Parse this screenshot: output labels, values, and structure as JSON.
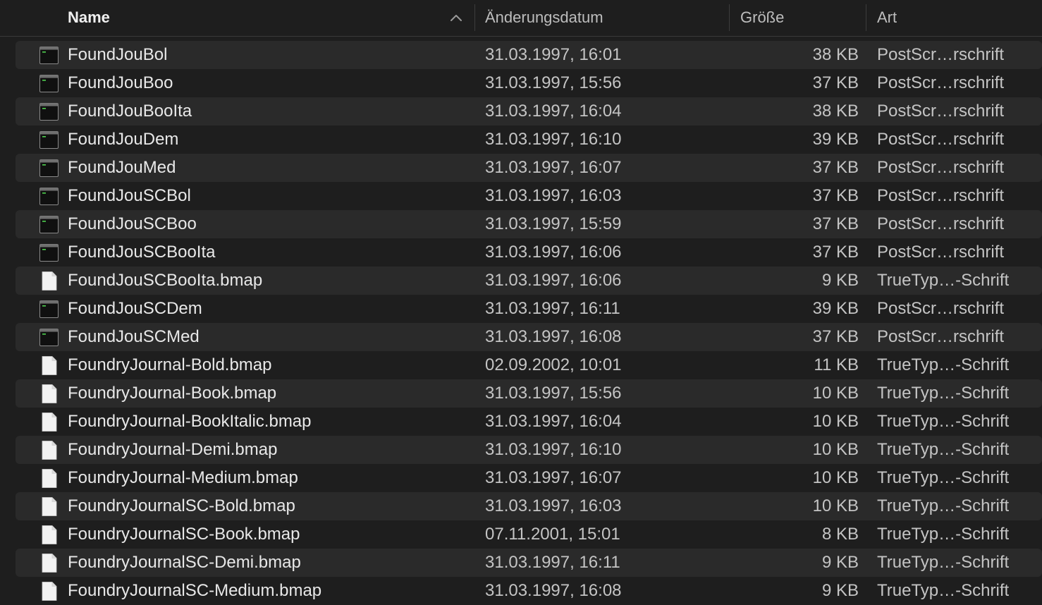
{
  "header": {
    "name_label": "Name",
    "date_label": "Änderungsdatum",
    "size_label": "Größe",
    "kind_label": "Art",
    "sort_icon": "chevron-up-icon"
  },
  "colors": {
    "background": "#1e1e1e",
    "row_alt": "#2a2a2a",
    "terminal_icon_green": "#4fd14f"
  },
  "files": [
    {
      "name": "FoundJouBol",
      "date": "31.03.1997, 16:01",
      "size": "38 KB",
      "kind": "PostScr…rschrift",
      "icon": "exec-icon"
    },
    {
      "name": "FoundJouBoo",
      "date": "31.03.1997, 15:56",
      "size": "37 KB",
      "kind": "PostScr…rschrift",
      "icon": "exec-icon"
    },
    {
      "name": "FoundJouBooIta",
      "date": "31.03.1997, 16:04",
      "size": "38 KB",
      "kind": "PostScr…rschrift",
      "icon": "exec-icon"
    },
    {
      "name": "FoundJouDem",
      "date": "31.03.1997, 16:10",
      "size": "39 KB",
      "kind": "PostScr…rschrift",
      "icon": "exec-icon"
    },
    {
      "name": "FoundJouMed",
      "date": "31.03.1997, 16:07",
      "size": "37 KB",
      "kind": "PostScr…rschrift",
      "icon": "exec-icon"
    },
    {
      "name": "FoundJouSCBol",
      "date": "31.03.1997, 16:03",
      "size": "37 KB",
      "kind": "PostScr…rschrift",
      "icon": "exec-icon"
    },
    {
      "name": "FoundJouSCBoo",
      "date": "31.03.1997, 15:59",
      "size": "37 KB",
      "kind": "PostScr…rschrift",
      "icon": "exec-icon"
    },
    {
      "name": "FoundJouSCBooIta",
      "date": "31.03.1997, 16:06",
      "size": "37 KB",
      "kind": "PostScr…rschrift",
      "icon": "exec-icon"
    },
    {
      "name": "FoundJouSCBooIta.bmap",
      "date": "31.03.1997, 16:06",
      "size": "9 KB",
      "kind": "TrueTyp…-Schrift",
      "icon": "document-icon"
    },
    {
      "name": "FoundJouSCDem",
      "date": "31.03.1997, 16:11",
      "size": "39 KB",
      "kind": "PostScr…rschrift",
      "icon": "exec-icon"
    },
    {
      "name": "FoundJouSCMed",
      "date": "31.03.1997, 16:08",
      "size": "37 KB",
      "kind": "PostScr…rschrift",
      "icon": "exec-icon"
    },
    {
      "name": "FoundryJournal-Bold.bmap",
      "date": "02.09.2002, 10:01",
      "size": "11 KB",
      "kind": "TrueTyp…-Schrift",
      "icon": "document-icon"
    },
    {
      "name": "FoundryJournal-Book.bmap",
      "date": "31.03.1997, 15:56",
      "size": "10 KB",
      "kind": "TrueTyp…-Schrift",
      "icon": "document-icon"
    },
    {
      "name": "FoundryJournal-BookItalic.bmap",
      "date": "31.03.1997, 16:04",
      "size": "10 KB",
      "kind": "TrueTyp…-Schrift",
      "icon": "document-icon"
    },
    {
      "name": "FoundryJournal-Demi.bmap",
      "date": "31.03.1997, 16:10",
      "size": "10 KB",
      "kind": "TrueTyp…-Schrift",
      "icon": "document-icon"
    },
    {
      "name": "FoundryJournal-Medium.bmap",
      "date": "31.03.1997, 16:07",
      "size": "10 KB",
      "kind": "TrueTyp…-Schrift",
      "icon": "document-icon"
    },
    {
      "name": "FoundryJournalSC-Bold.bmap",
      "date": "31.03.1997, 16:03",
      "size": "10 KB",
      "kind": "TrueTyp…-Schrift",
      "icon": "document-icon"
    },
    {
      "name": "FoundryJournalSC-Book.bmap",
      "date": "07.11.2001, 15:01",
      "size": "8 KB",
      "kind": "TrueTyp…-Schrift",
      "icon": "document-icon"
    },
    {
      "name": "FoundryJournalSC-Demi.bmap",
      "date": "31.03.1997, 16:11",
      "size": "9 KB",
      "kind": "TrueTyp…-Schrift",
      "icon": "document-icon"
    },
    {
      "name": "FoundryJournalSC-Medium.bmap",
      "date": "31.03.1997, 16:08",
      "size": "9 KB",
      "kind": "TrueTyp…-Schrift",
      "icon": "document-icon"
    }
  ]
}
